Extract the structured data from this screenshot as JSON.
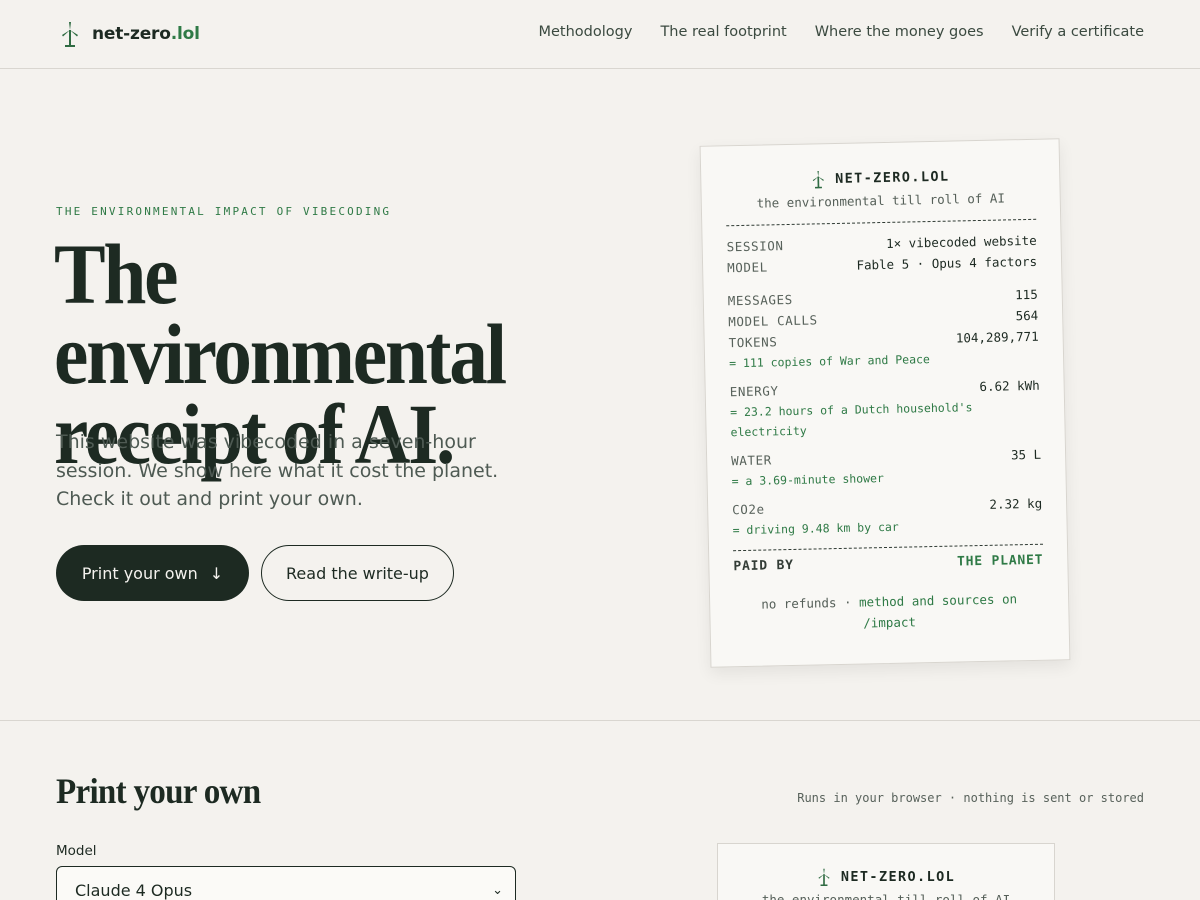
{
  "header": {
    "logo_name": "net-zero",
    "logo_tld": ".lol",
    "nav": [
      {
        "label": "Methodology"
      },
      {
        "label": "The real footprint"
      },
      {
        "label": "Where the money goes"
      },
      {
        "label": "Verify a certificate"
      }
    ]
  },
  "hero": {
    "eyebrow": "The environmental impact of vibecoding",
    "title_line1": "The environmental",
    "title_line2": "receipt of AI.",
    "subtitle": "This website was vibecoded in a seven-hour session. We show here what it cost the planet. Check it out and print your own.",
    "primary_button": "Print your own",
    "secondary_button": "Read the write-up"
  },
  "receipt": {
    "brand": "NET-ZERO.LOL",
    "tagline": "the environmental till roll of AI",
    "session_label": "SESSION",
    "session_value": "1× vibecoded website",
    "model_label": "MODEL",
    "model_value": "Fable 5 · Opus 4 factors",
    "messages_label": "MESSAGES",
    "messages_value": "115",
    "calls_label": "MODEL CALLS",
    "calls_value": "564",
    "tokens_label": "TOKENS",
    "tokens_value": "104,289,771",
    "tokens_note": "= 111 copies of War and Peace",
    "energy_label": "ENERGY",
    "energy_value": "6.62 kWh",
    "energy_note": "= 23.2 hours of a Dutch household's electricity",
    "water_label": "WATER",
    "water_value": "35 L",
    "water_note": "= a 3.69-minute shower",
    "co2_label": "CO2e",
    "co2_value": "2.32 kg",
    "co2_note": "= driving 9.48 km by car",
    "paid_label": "PAID BY",
    "paid_value": "THE PLANET",
    "footer_prefix": "no refunds ·",
    "footer_link": "method and sources on /impact"
  },
  "section": {
    "title": "Print your own",
    "meta": "Runs in your browser · nothing is sent or stored",
    "model_field_label": "Model",
    "model_selected": "Claude 4 Opus"
  },
  "receipt2": {
    "brand": "NET-ZERO.LOL",
    "tagline": "the environmental till roll of AI"
  },
  "colors": {
    "background": "#f4f2ee",
    "ink": "#1d2a22",
    "accent_green": "#2f7a46"
  }
}
